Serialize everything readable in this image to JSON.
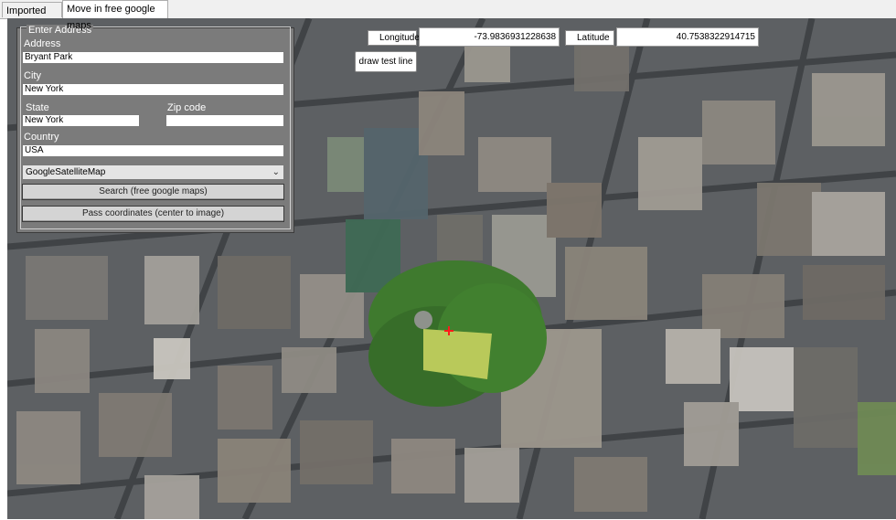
{
  "tabs": [
    {
      "label": "Imported Map",
      "active": false
    },
    {
      "label": "Move in free google maps",
      "active": true
    }
  ],
  "address_panel": {
    "legend": "Enter Address",
    "address_label": "Address",
    "address_value": "Bryant Park",
    "city_label": "City",
    "city_value": "New York",
    "state_label": "State",
    "state_value": "New York",
    "zip_label": "Zip code",
    "zip_value": "",
    "country_label": "Country",
    "country_value": "USA",
    "map_type_selected": "GoogleSatelliteMap",
    "search_button": "Search (free google maps)",
    "pass_button": "Pass coordinates (center to image)"
  },
  "coordinates": {
    "longitude_label": "Longitude",
    "longitude_value": "-73.9836931228638",
    "latitude_label": "Latitude",
    "latitude_value": "40.7538322914715"
  },
  "draw_test_line_button": "draw test line",
  "icons": {
    "dropdown": "chevron-down-icon",
    "center_marker": "crosshair-icon"
  },
  "colors": {
    "panel_bg": "#7b7b7b",
    "marker": "#ff1a1a",
    "park_lawn": "#b9c95a",
    "park_trees": "#3f7a2e"
  }
}
